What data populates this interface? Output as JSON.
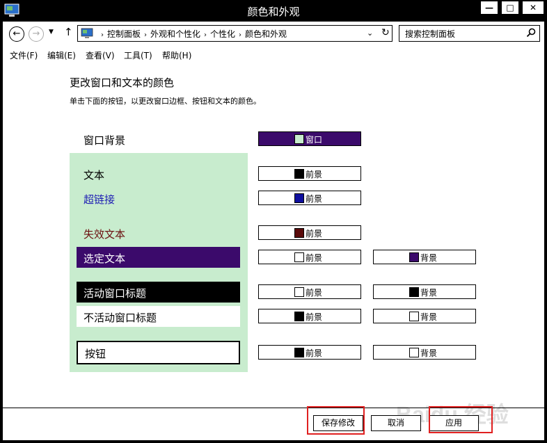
{
  "window": {
    "title": "颜色和外观",
    "controls": {
      "minimize": "—",
      "maximize": "□",
      "close": "✕"
    }
  },
  "address": {
    "back": "←",
    "forward": "→",
    "dropdown": "▼",
    "up": "↑",
    "crumbs": [
      "控制面板",
      "外观和个性化",
      "个性化",
      "颜色和外观"
    ],
    "separator": "›",
    "addr_dropdown": "⌄",
    "refresh": "↻",
    "search_placeholder": "搜索控制面板"
  },
  "menu": [
    "文件(F)",
    "编辑(E)",
    "查看(V)",
    "工具(T)",
    "帮助(H)"
  ],
  "content": {
    "heading": "更改窗口和文本的颜色",
    "subtext": "单击下面的按钮，以更改窗口边框、按钮和文本的颜色。",
    "window_background_label": "窗口背景",
    "window_btn": {
      "label": "窗口",
      "swatch": "#c8ecce",
      "bg": "#3b0a6b",
      "text_color": "#ffffff"
    }
  },
  "preview": {
    "bg": "#c8ecce",
    "text": {
      "label": "文本",
      "color": "#000000"
    },
    "hyperlink": {
      "label": "超链接",
      "color": "#1f1fb4"
    },
    "disabled": {
      "label": "失效文本",
      "color": "#6b0f0f"
    },
    "selected": {
      "label": "选定文本",
      "bg": "#3b0a6b",
      "color": "#ffffff"
    },
    "active_title": {
      "label": "活动窗口标题",
      "bg": "#000000",
      "color": "#ffffff"
    },
    "inactive_title": {
      "label": "不活动窗口标题",
      "bg": "#ffffff",
      "color": "#000000"
    },
    "button": {
      "label": "按钮",
      "bg": "#ffffff",
      "color": "#000000"
    }
  },
  "color_buttons": {
    "fg_label": "前景",
    "bg_label": "背景",
    "text_fg": "#000000",
    "hyperlink_fg": "#0f0f9e",
    "disabled_fg": "#5a0a0a",
    "selected_fg": "#ffffff",
    "selected_bg": "#3b0a6b",
    "active_fg": "#ffffff",
    "active_bg": "#000000",
    "inactive_fg": "#000000",
    "inactive_bg": "#ffffff",
    "button_fg": "#000000",
    "button_bg": "#ffffff"
  },
  "footer": {
    "save": "保存修改",
    "cancel": "取消",
    "apply": "应用",
    "highlight_color": "#e02020"
  },
  "watermark": "Baidu 经验"
}
